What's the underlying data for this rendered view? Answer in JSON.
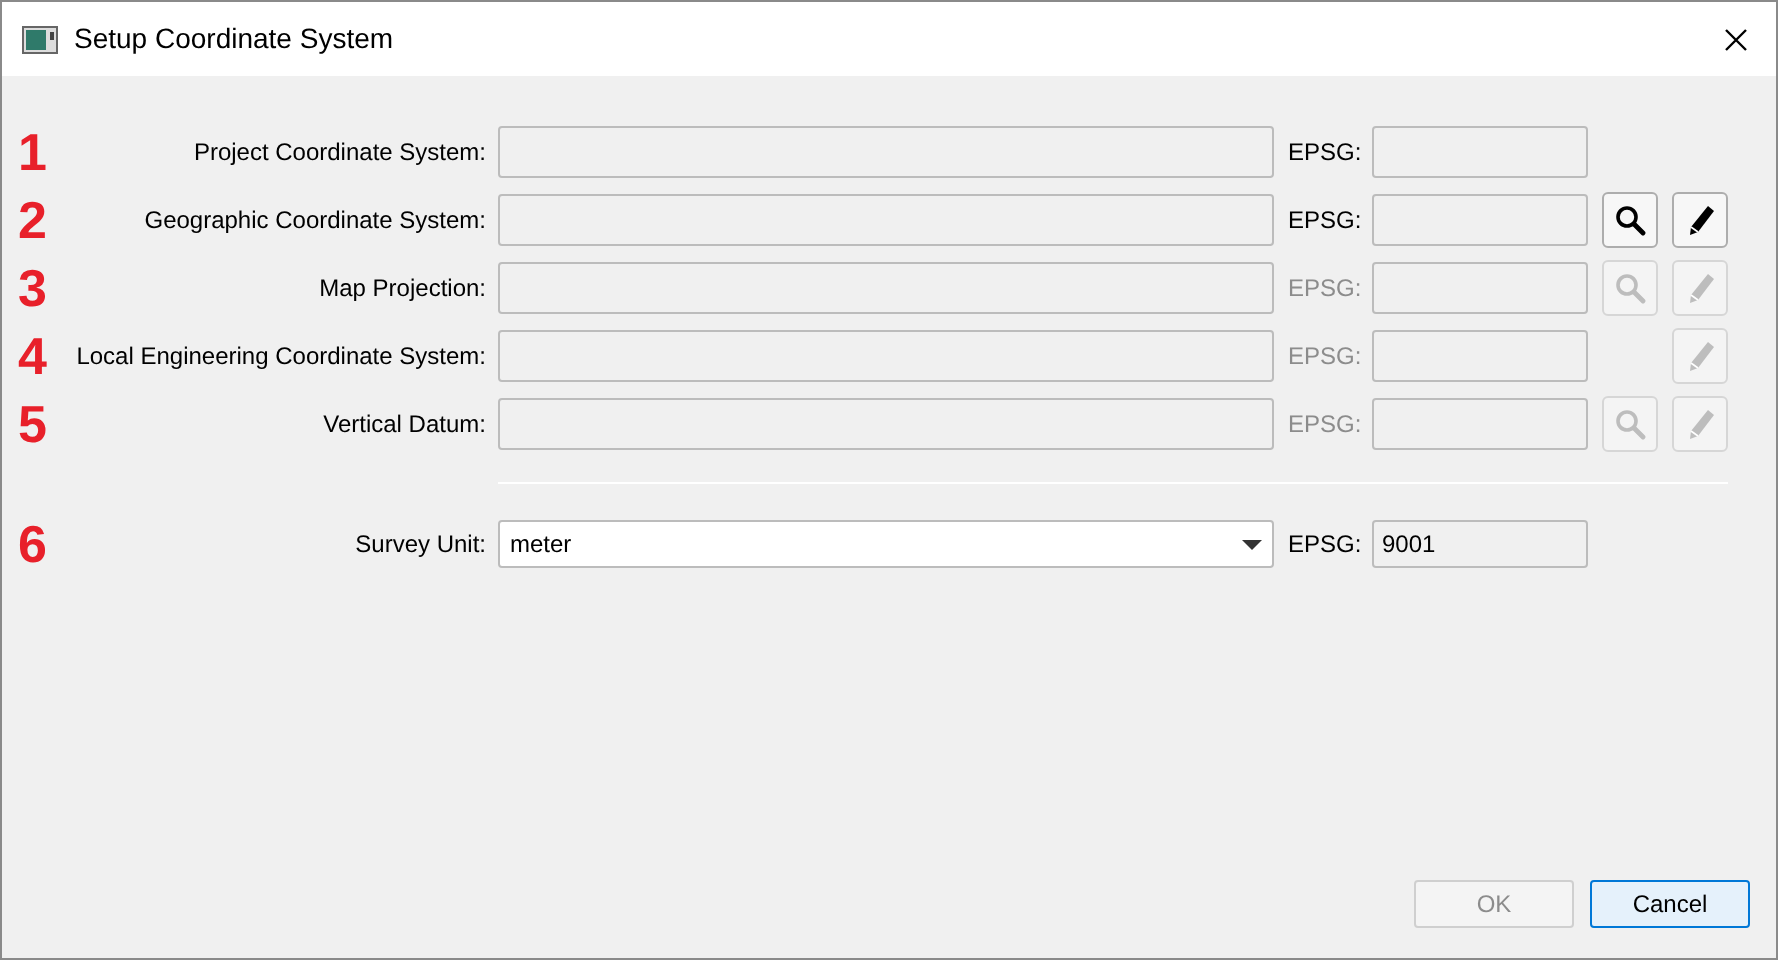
{
  "window": {
    "title": "Setup Coordinate System"
  },
  "rows": [
    {
      "number": "1",
      "label": "Project Coordinate System:",
      "epsg_label": "EPSG:",
      "epsg_disabled": false
    },
    {
      "number": "2",
      "label": "Geographic Coordinate System:",
      "epsg_label": "EPSG:",
      "epsg_disabled": false,
      "actions": [
        {
          "kind": "search",
          "disabled": false
        },
        {
          "kind": "edit",
          "disabled": false
        }
      ]
    },
    {
      "number": "3",
      "label": "Map Projection:",
      "epsg_label": "EPSG:",
      "epsg_disabled": true,
      "actions": [
        {
          "kind": "search",
          "disabled": true
        },
        {
          "kind": "edit",
          "disabled": true
        }
      ]
    },
    {
      "number": "4",
      "label": "Local Engineering Coordinate System:",
      "epsg_label": "EPSG:",
      "epsg_disabled": true,
      "actions": [
        {
          "kind": "edit",
          "disabled": true
        }
      ]
    },
    {
      "number": "5",
      "label": "Vertical Datum:",
      "epsg_label": "EPSG:",
      "epsg_disabled": true,
      "actions": [
        {
          "kind": "search",
          "disabled": true
        },
        {
          "kind": "edit",
          "disabled": true
        }
      ]
    }
  ],
  "survey": {
    "number": "6",
    "label": "Survey Unit:",
    "value": "meter",
    "epsg_label": "EPSG:",
    "epsg_value": "9001"
  },
  "buttons": [
    {
      "label": "OK",
      "disabled": true,
      "focused": false
    },
    {
      "label": "Cancel",
      "disabled": false,
      "focused": true
    }
  ]
}
